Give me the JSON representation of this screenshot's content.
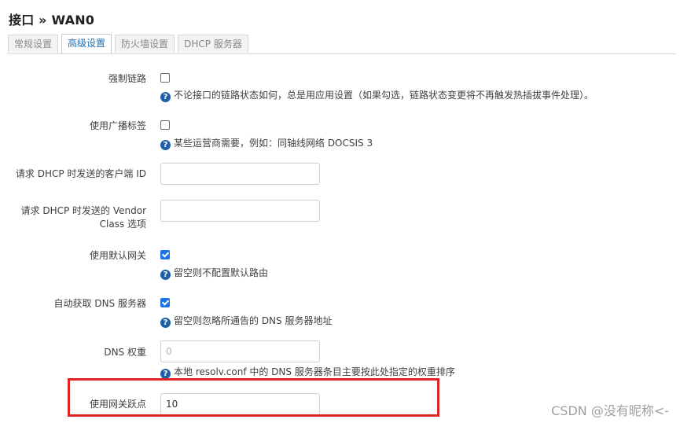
{
  "page": {
    "title": "接口 » WAN0"
  },
  "tabs": [
    {
      "label": "常规设置",
      "active": false
    },
    {
      "label": "高级设置",
      "active": true
    },
    {
      "label": "防火墙设置",
      "active": false
    },
    {
      "label": "DHCP 服务器",
      "active": false
    }
  ],
  "form": {
    "force_link": {
      "label": "强制链路",
      "checked": false,
      "help": "不论接口的链路状态如何，总是用应用设置（如果勾选，链路状态变更将不再触发热插拔事件处理）。"
    },
    "broadcast_flag": {
      "label": "使用广播标签",
      "checked": false,
      "help": "某些运营商需要，例如：同轴线网络 DOCSIS 3"
    },
    "client_id": {
      "label": "请求 DHCP 时发送的客户端 ID",
      "value": ""
    },
    "vendor_class": {
      "label_line1": "请求 DHCP 时发送的 Vendor",
      "label_line2": "Class 选项",
      "value": ""
    },
    "default_gateway": {
      "label": "使用默认网关",
      "checked": true,
      "help": "留空则不配置默认路由"
    },
    "peer_dns": {
      "label": "自动获取 DNS 服务器",
      "checked": true,
      "help": "留空则忽略所通告的 DNS 服务器地址"
    },
    "dns_weight": {
      "label": "DNS 权重",
      "placeholder": "0",
      "help": "本地 resolv.conf 中的 DNS 服务器条目主要按此处指定的权重排序"
    },
    "gateway_metric": {
      "label": "使用网关跃点",
      "value": "10"
    }
  },
  "help_icon_glyph": "?",
  "watermark": "CSDN @没有昵称<-",
  "colors": {
    "accent": "#1a73e8",
    "help_icon": "#1f5fa8",
    "highlight_box": "#e02424",
    "active_tab_text": "#1f6fb2"
  }
}
